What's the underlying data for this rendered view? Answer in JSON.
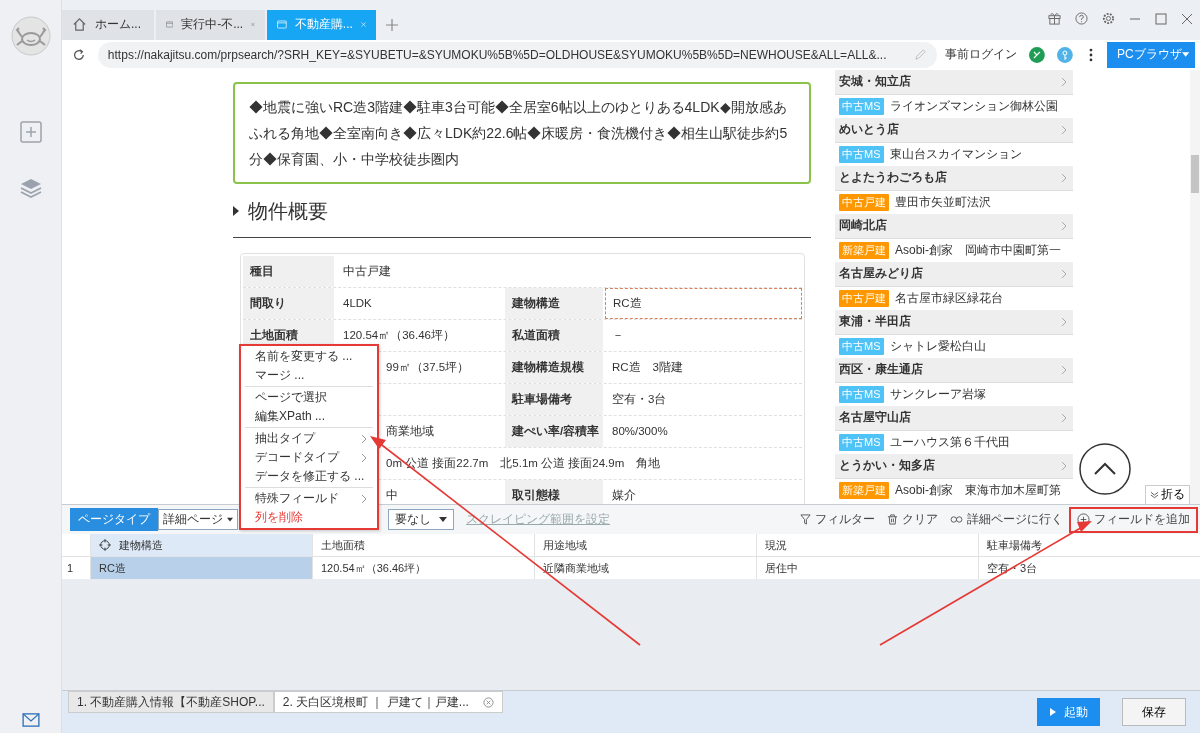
{
  "browser_tabs": [
    {
      "label": "ホーム...",
      "kind": "home",
      "selected": false,
      "closable": false
    },
    {
      "label": "実行中-不...",
      "kind": "page",
      "selected": false,
      "closable": true
    },
    {
      "label": "不動産購...",
      "kind": "page",
      "selected": true,
      "closable": true
    }
  ],
  "url": "https://nakajitsu.com/prpsearch/?SRH_KEY=&SYUBETU=&SYUMOKU%5B%5D=OLDHOUSE&SYUMOKU%5B%5D=NEWHOUSE&ALL=ALL&...",
  "login_label": "事前ログイン",
  "mode_button": "PCブラウザ",
  "intro": "◆地震に強いRC造3階建◆駐車3台可能◆全居室6帖以上のゆとりある4LDK◆開放感あふれる角地◆全室南向き◆広々LDK約22.6帖◆床暖房・食洗機付き◆相生山駅徒歩約5分◆保育園、小・中学校徒歩圏内",
  "heading": "物件概要",
  "spec_rows": [
    {
      "label": "種目",
      "value": "中古戸建",
      "highlighted": false
    },
    {
      "label": "間取り",
      "value": "4LDK",
      "label2": "建物構造",
      "value2": "RC造",
      "highlighted": true
    },
    {
      "label": "土地面積",
      "value": "120.54㎡（36.46坪）",
      "label2": "私道面積",
      "value2": "－",
      "highlighted": false
    },
    {
      "value": "99㎡（37.5坪）",
      "label2": "建物構造規模",
      "value2": "RC造　3階建",
      "highlighted": false
    },
    {
      "label2": "駐車場備考",
      "value2": "空有・3台",
      "highlighted": false
    },
    {
      "value": "商業地域",
      "label2": "建ぺい率/容積率",
      "value2": "80%/300%",
      "highlighted": false
    },
    {
      "value": "0m 公道 接面22.7m　北5.1m 公道 接面24.9m　角地",
      "highlighted": false
    },
    {
      "value": "中",
      "label2": "取引態様",
      "value2": "媒介",
      "highlighted": false
    }
  ],
  "shops": [
    {
      "name": "安城・知立店",
      "tag": "中古MS",
      "color": "#4fc3f7",
      "property": "ライオンズマンション御林公園"
    },
    {
      "name": "めいとう店",
      "tag": "中古MS",
      "color": "#4fc3f7",
      "property": "東山台スカイマンション"
    },
    {
      "name": "とよたうわごろも店",
      "tag": "中古戸建",
      "color": "#ff9800",
      "property": "豊田市矢並町法沢"
    },
    {
      "name": "岡崎北店",
      "tag": "新築戸建",
      "color": "#ff9800",
      "property": "Asobi-創家　岡崎市中園町第一"
    },
    {
      "name": "名古屋みどり店",
      "tag": "中古戸建",
      "color": "#ff9800",
      "property": "名古屋市緑区緑花台"
    },
    {
      "name": "東浦・半田店",
      "tag": "中古MS",
      "color": "#4fc3f7",
      "property": "シャトレ愛松白山"
    },
    {
      "name": "西区・康生通店",
      "tag": "中古MS",
      "color": "#4fc3f7",
      "property": "サンクレーア岩塚"
    },
    {
      "name": "名古屋守山店",
      "tag": "中古MS",
      "color": "#4fc3f7",
      "property": "ユーハウス第６千代田"
    },
    {
      "name": "とうかい・知多店",
      "tag": "新築戸建",
      "color": "#ff9800",
      "property": "Asobi-創家　東海市加木屋町第"
    }
  ],
  "collapse_button": "折る",
  "context_menu": [
    {
      "kind": "action",
      "label": "名前を変更する ..."
    },
    {
      "kind": "action",
      "label": "マージ ..."
    },
    {
      "kind": "separator"
    },
    {
      "kind": "action",
      "label": "ページで選択"
    },
    {
      "kind": "action",
      "label": "編集XPath ..."
    },
    {
      "kind": "separator"
    },
    {
      "kind": "submenu",
      "label": "抽出タイプ"
    },
    {
      "kind": "submenu",
      "label": "デコードタイプ"
    },
    {
      "kind": "action",
      "label": "データを修正する ..."
    },
    {
      "kind": "separator"
    },
    {
      "kind": "submenu",
      "label": "特殊フィールド"
    },
    {
      "kind": "danger",
      "label": "列を削除"
    }
  ],
  "panel": {
    "page_type_label": "ページタイプ",
    "page_type": "詳細ページ",
    "second_select": "要なし",
    "scrape_link": "スクレイピング範囲を設定",
    "actions": [
      {
        "kind": "filter",
        "label": "フィルター"
      },
      {
        "kind": "clear",
        "label": "クリア"
      },
      {
        "kind": "link",
        "label": "詳細ページに行く"
      },
      {
        "kind": "add",
        "label": "フィールドを追加"
      }
    ],
    "columns": [
      {
        "label": "建物構造",
        "selected": true
      },
      {
        "label": "土地面積",
        "selected": false
      },
      {
        "label": "用途地域",
        "selected": false
      },
      {
        "label": "現況",
        "selected": false
      },
      {
        "label": "駐車場備考",
        "selected": false
      }
    ],
    "rows": [
      {
        "number": "1",
        "cells": [
          "RC造",
          "120.54㎡（36.46坪）",
          "近隣商業地域",
          "居住中",
          "空有・3台"
        ]
      }
    ]
  },
  "task_tabs": [
    {
      "label": "1. 不動産購入情報【不動産SHOP...",
      "selected": false
    },
    {
      "label": "2. 天白区境根町 ｜ 戸建て｜戸建...",
      "selected": true
    }
  ],
  "start_button": "起動",
  "save_button": "保存"
}
